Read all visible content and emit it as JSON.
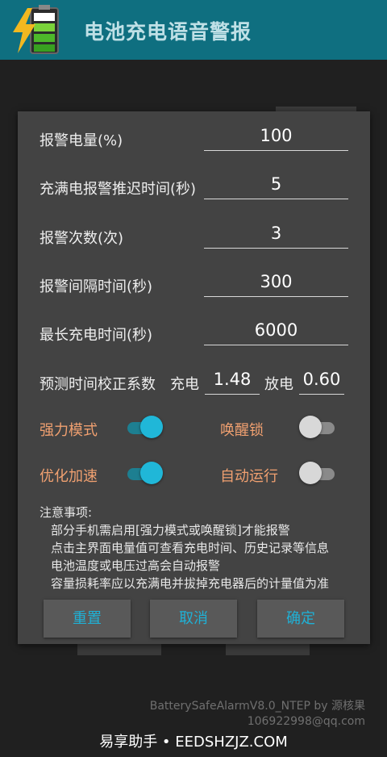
{
  "app": {
    "title": "电池充电语音警报",
    "icon": "battery-charging-icon"
  },
  "settings": {
    "level": {
      "label": "报警电量(%)",
      "value": "100"
    },
    "delay": {
      "label": "充满电报警推迟时间(秒)",
      "value": "5"
    },
    "count": {
      "label": "报警次数(次)",
      "value": "3"
    },
    "interval": {
      "label": "报警间隔时间(秒)",
      "value": "300"
    },
    "max_time": {
      "label": "最长充电时间(秒)",
      "value": "6000"
    },
    "predict": {
      "label": "预测时间校正系数",
      "charge_label": "充电",
      "charge_value": "1.48",
      "discharge_label": "放电",
      "discharge_value": "0.60"
    }
  },
  "toggles": {
    "strong_mode": {
      "label": "强力模式",
      "on": true
    },
    "wake_lock": {
      "label": "唤醒锁",
      "on": false
    },
    "optimize": {
      "label": "优化加速",
      "on": true
    },
    "autorun": {
      "label": "自动运行",
      "on": false
    }
  },
  "notes": {
    "title": "注意事项:",
    "items": [
      "部分手机需启用[强力模式或唤醒锁]才能报警",
      "点击主界面电量值可查看充电时间、历史记录等信息",
      "电池温度或电压过高会自动报警",
      "容量损耗率应以充满电并拔掉充电器后的计量值为准"
    ]
  },
  "buttons": {
    "reset": "重置",
    "cancel": "取消",
    "ok": "确定"
  },
  "footer": {
    "version": "BatterySafeAlarmV8.0_NTEP by 源核果",
    "email": "106922998@qq.com",
    "watermark": "易享助手 • EEDSHZJZ.COM"
  },
  "colors": {
    "appbar": "#0f6f80",
    "accent": "#20b7d8",
    "toggle_label": "#f0a070",
    "dialog": "#434343"
  }
}
